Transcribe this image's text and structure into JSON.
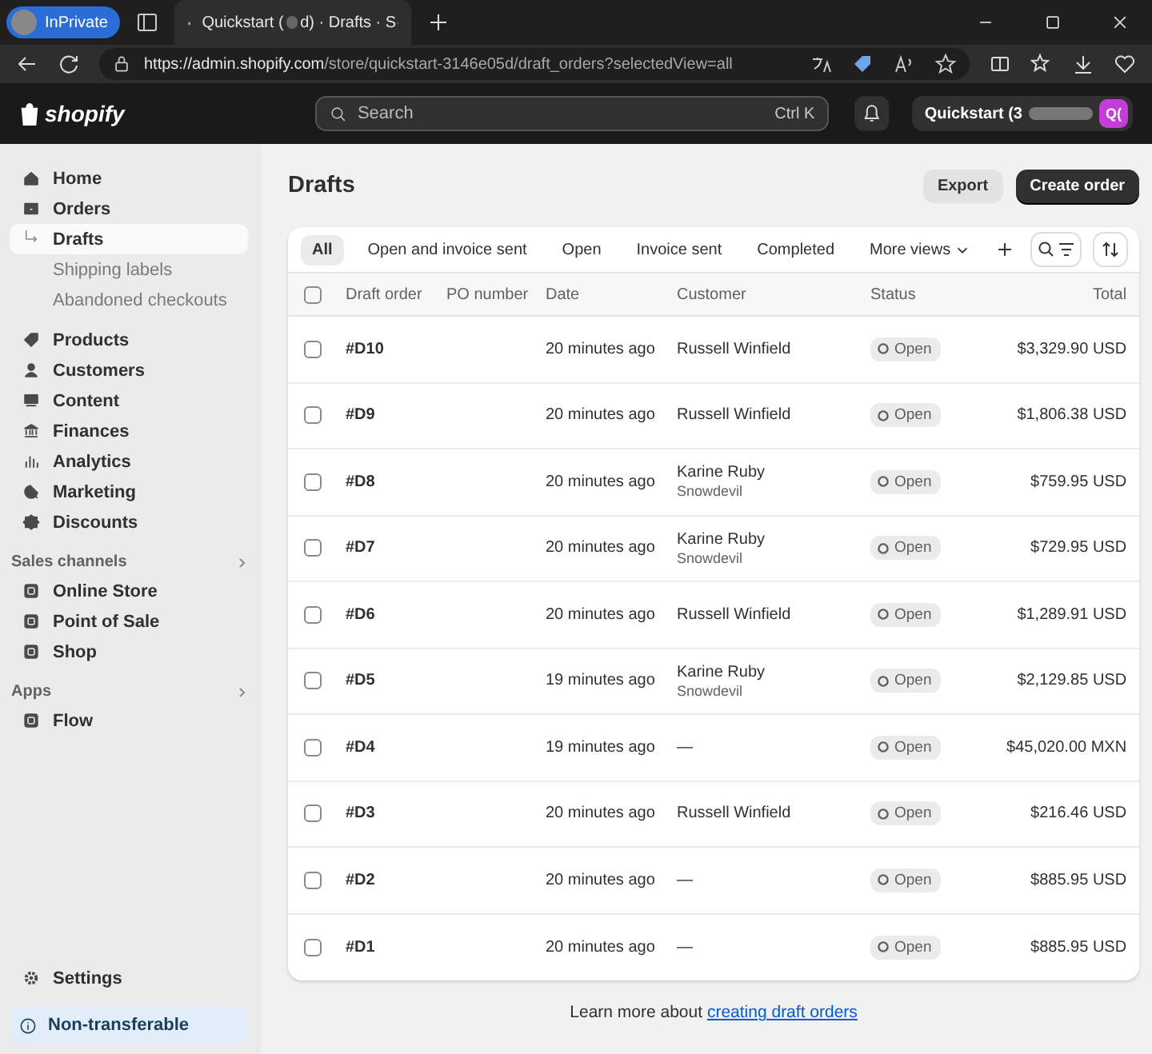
{
  "browser": {
    "profile": "InPrivate",
    "tab_title_start": "Quickstart (",
    "tab_title_end": "d) · Drafts · S",
    "url_host": "https://admin.shopify.com",
    "url_path": "/store/quickstart-3146e05d/draft_orders?selectedView=all"
  },
  "topbar": {
    "logo": "shopify",
    "search": {
      "placeholder": "Search",
      "shortcut": "Ctrl K"
    },
    "store": "Quickstart (3",
    "avatar": "Q("
  },
  "sidebar": {
    "items": [
      {
        "label": "Home",
        "kind": "main",
        "selected": false
      },
      {
        "label": "Orders",
        "kind": "main",
        "selected": false
      },
      {
        "label": "Drafts",
        "kind": "sub",
        "selected": true
      },
      {
        "label": "Shipping labels",
        "kind": "sub",
        "selected": false
      },
      {
        "label": "Abandoned checkouts",
        "kind": "sub",
        "selected": false
      },
      {
        "label": "Products",
        "kind": "main",
        "selected": false
      },
      {
        "label": "Customers",
        "kind": "main",
        "selected": false
      },
      {
        "label": "Content",
        "kind": "main",
        "selected": false
      },
      {
        "label": "Finances",
        "kind": "main",
        "selected": false
      },
      {
        "label": "Analytics",
        "kind": "main",
        "selected": false
      },
      {
        "label": "Marketing",
        "kind": "main",
        "selected": false
      },
      {
        "label": "Discounts",
        "kind": "main",
        "selected": false
      }
    ],
    "sections": [
      {
        "title": "Sales channels",
        "items": [
          "Online Store",
          "Point of Sale",
          "Shop"
        ]
      },
      {
        "title": "Apps",
        "items": [
          "Flow"
        ]
      }
    ],
    "settings": "Settings",
    "notice": "Non-transferable"
  },
  "page": {
    "title": "Drafts",
    "buttons": [
      "Export",
      "Create order"
    ],
    "views": [
      {
        "label": "All",
        "selected": true
      },
      {
        "label": "Open and invoice sent",
        "selected": false
      },
      {
        "label": "Open",
        "selected": false
      },
      {
        "label": "Invoice sent",
        "selected": false
      },
      {
        "label": "Completed",
        "selected": false
      },
      {
        "label": "More views",
        "selected": false
      }
    ],
    "select_all_checked": false,
    "columns": [
      "Draft order",
      "PO number",
      "Date",
      "Customer",
      "Status",
      "Total"
    ],
    "rows": [
      {
        "order": "#D10",
        "date": "20 minutes ago",
        "customer": "Russell Winfield",
        "status": "Open",
        "total": "$3,329.90 USD",
        "selected": false
      },
      {
        "order": "#D9",
        "date": "20 minutes ago",
        "customer": "Russell Winfield",
        "status": "Open",
        "total": "$1,806.38 USD",
        "selected": false
      },
      {
        "order": "#D8",
        "date": "20 minutes ago",
        "customer": "Karine Ruby",
        "company": "Snowdevil",
        "status": "Open",
        "total": "$759.95 USD",
        "selected": false
      },
      {
        "order": "#D7",
        "date": "20 minutes ago",
        "customer": "Karine Ruby",
        "company": "Snowdevil",
        "status": "Open",
        "total": "$729.95 USD",
        "selected": false
      },
      {
        "order": "#D6",
        "date": "20 minutes ago",
        "customer": "Russell Winfield",
        "status": "Open",
        "total": "$1,289.91 USD",
        "selected": false
      },
      {
        "order": "#D5",
        "date": "19 minutes ago",
        "customer": "Karine Ruby",
        "company": "Snowdevil",
        "status": "Open",
        "total": "$2,129.85 USD",
        "selected": false
      },
      {
        "order": "#D4",
        "date": "19 minutes ago",
        "customer": "—",
        "status": "Open",
        "total": "$45,020.00 MXN",
        "selected": false
      },
      {
        "order": "#D3",
        "date": "20 minutes ago",
        "customer": "Russell Winfield",
        "status": "Open",
        "total": "$216.46 USD",
        "selected": false
      },
      {
        "order": "#D2",
        "date": "20 minutes ago",
        "customer": "—",
        "status": "Open",
        "total": "$885.95 USD",
        "selected": false
      },
      {
        "order": "#D1",
        "date": "20 minutes ago",
        "customer": "—",
        "status": "Open",
        "total": "$885.95 USD",
        "selected": false
      }
    ],
    "footer_text": "Learn more about ",
    "footer_link": "creating draft orders"
  }
}
